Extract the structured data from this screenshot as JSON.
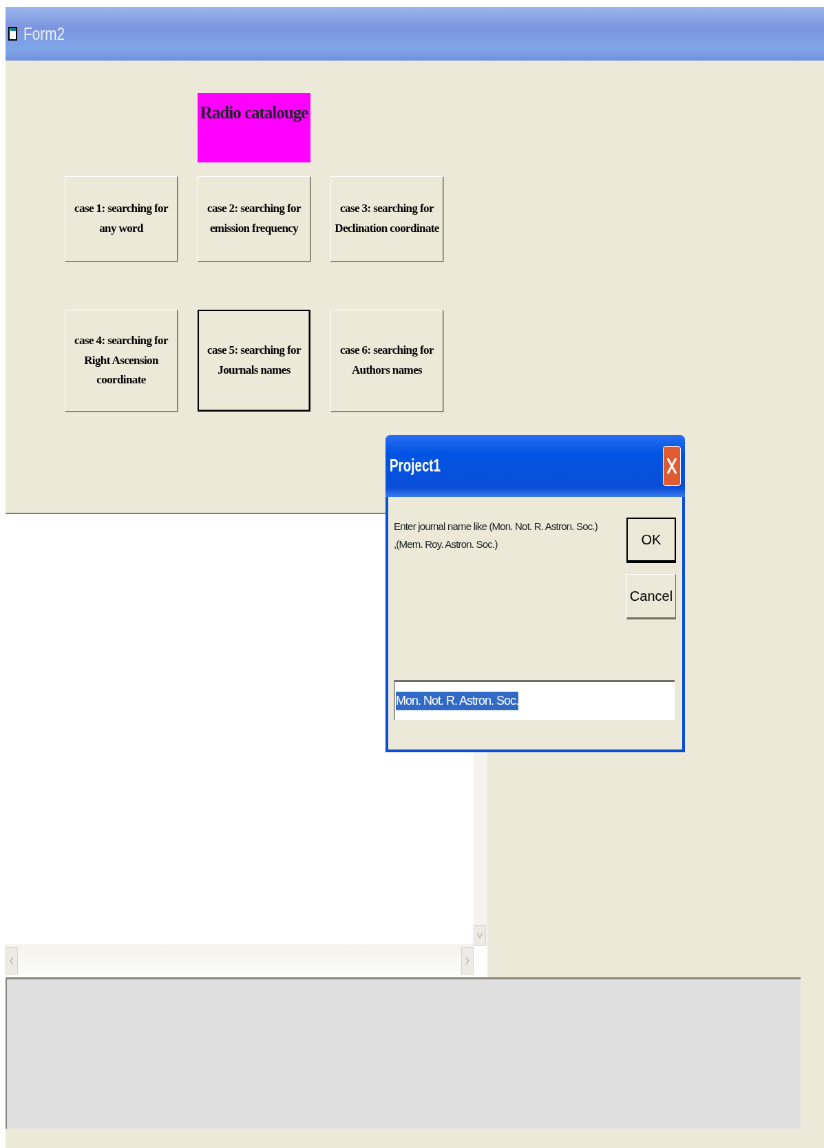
{
  "window": {
    "title": "Form2"
  },
  "header_label": {
    "text": "Radio catalouge"
  },
  "case_buttons": [
    {
      "label": "case 1: searching for\nany word",
      "selected": false
    },
    {
      "label": "case 2: searching for\nemission frequency",
      "selected": false
    },
    {
      "label": "case 3: searching for\nDeclination coordinate",
      "selected": false
    },
    {
      "label": "case 4: searching for\nRight Ascension\ncoordinate",
      "selected": false
    },
    {
      "label": "case 5: searching for\nJournals names",
      "selected": true
    },
    {
      "label": "case 6: searching for\nAuthors names",
      "selected": false
    }
  ],
  "dialog": {
    "title": "Project1",
    "message": "Enter journal name like (Mon. Not. R. Astron. Soc.)\n,(Mem. Roy. Astron. Soc.)",
    "buttons": [
      {
        "label": "OK",
        "default": true
      },
      {
        "label": "Cancel",
        "default": false
      }
    ],
    "input": {
      "value": "Mon. Not. R. Astron. Soc.",
      "text_selected": true
    }
  }
}
